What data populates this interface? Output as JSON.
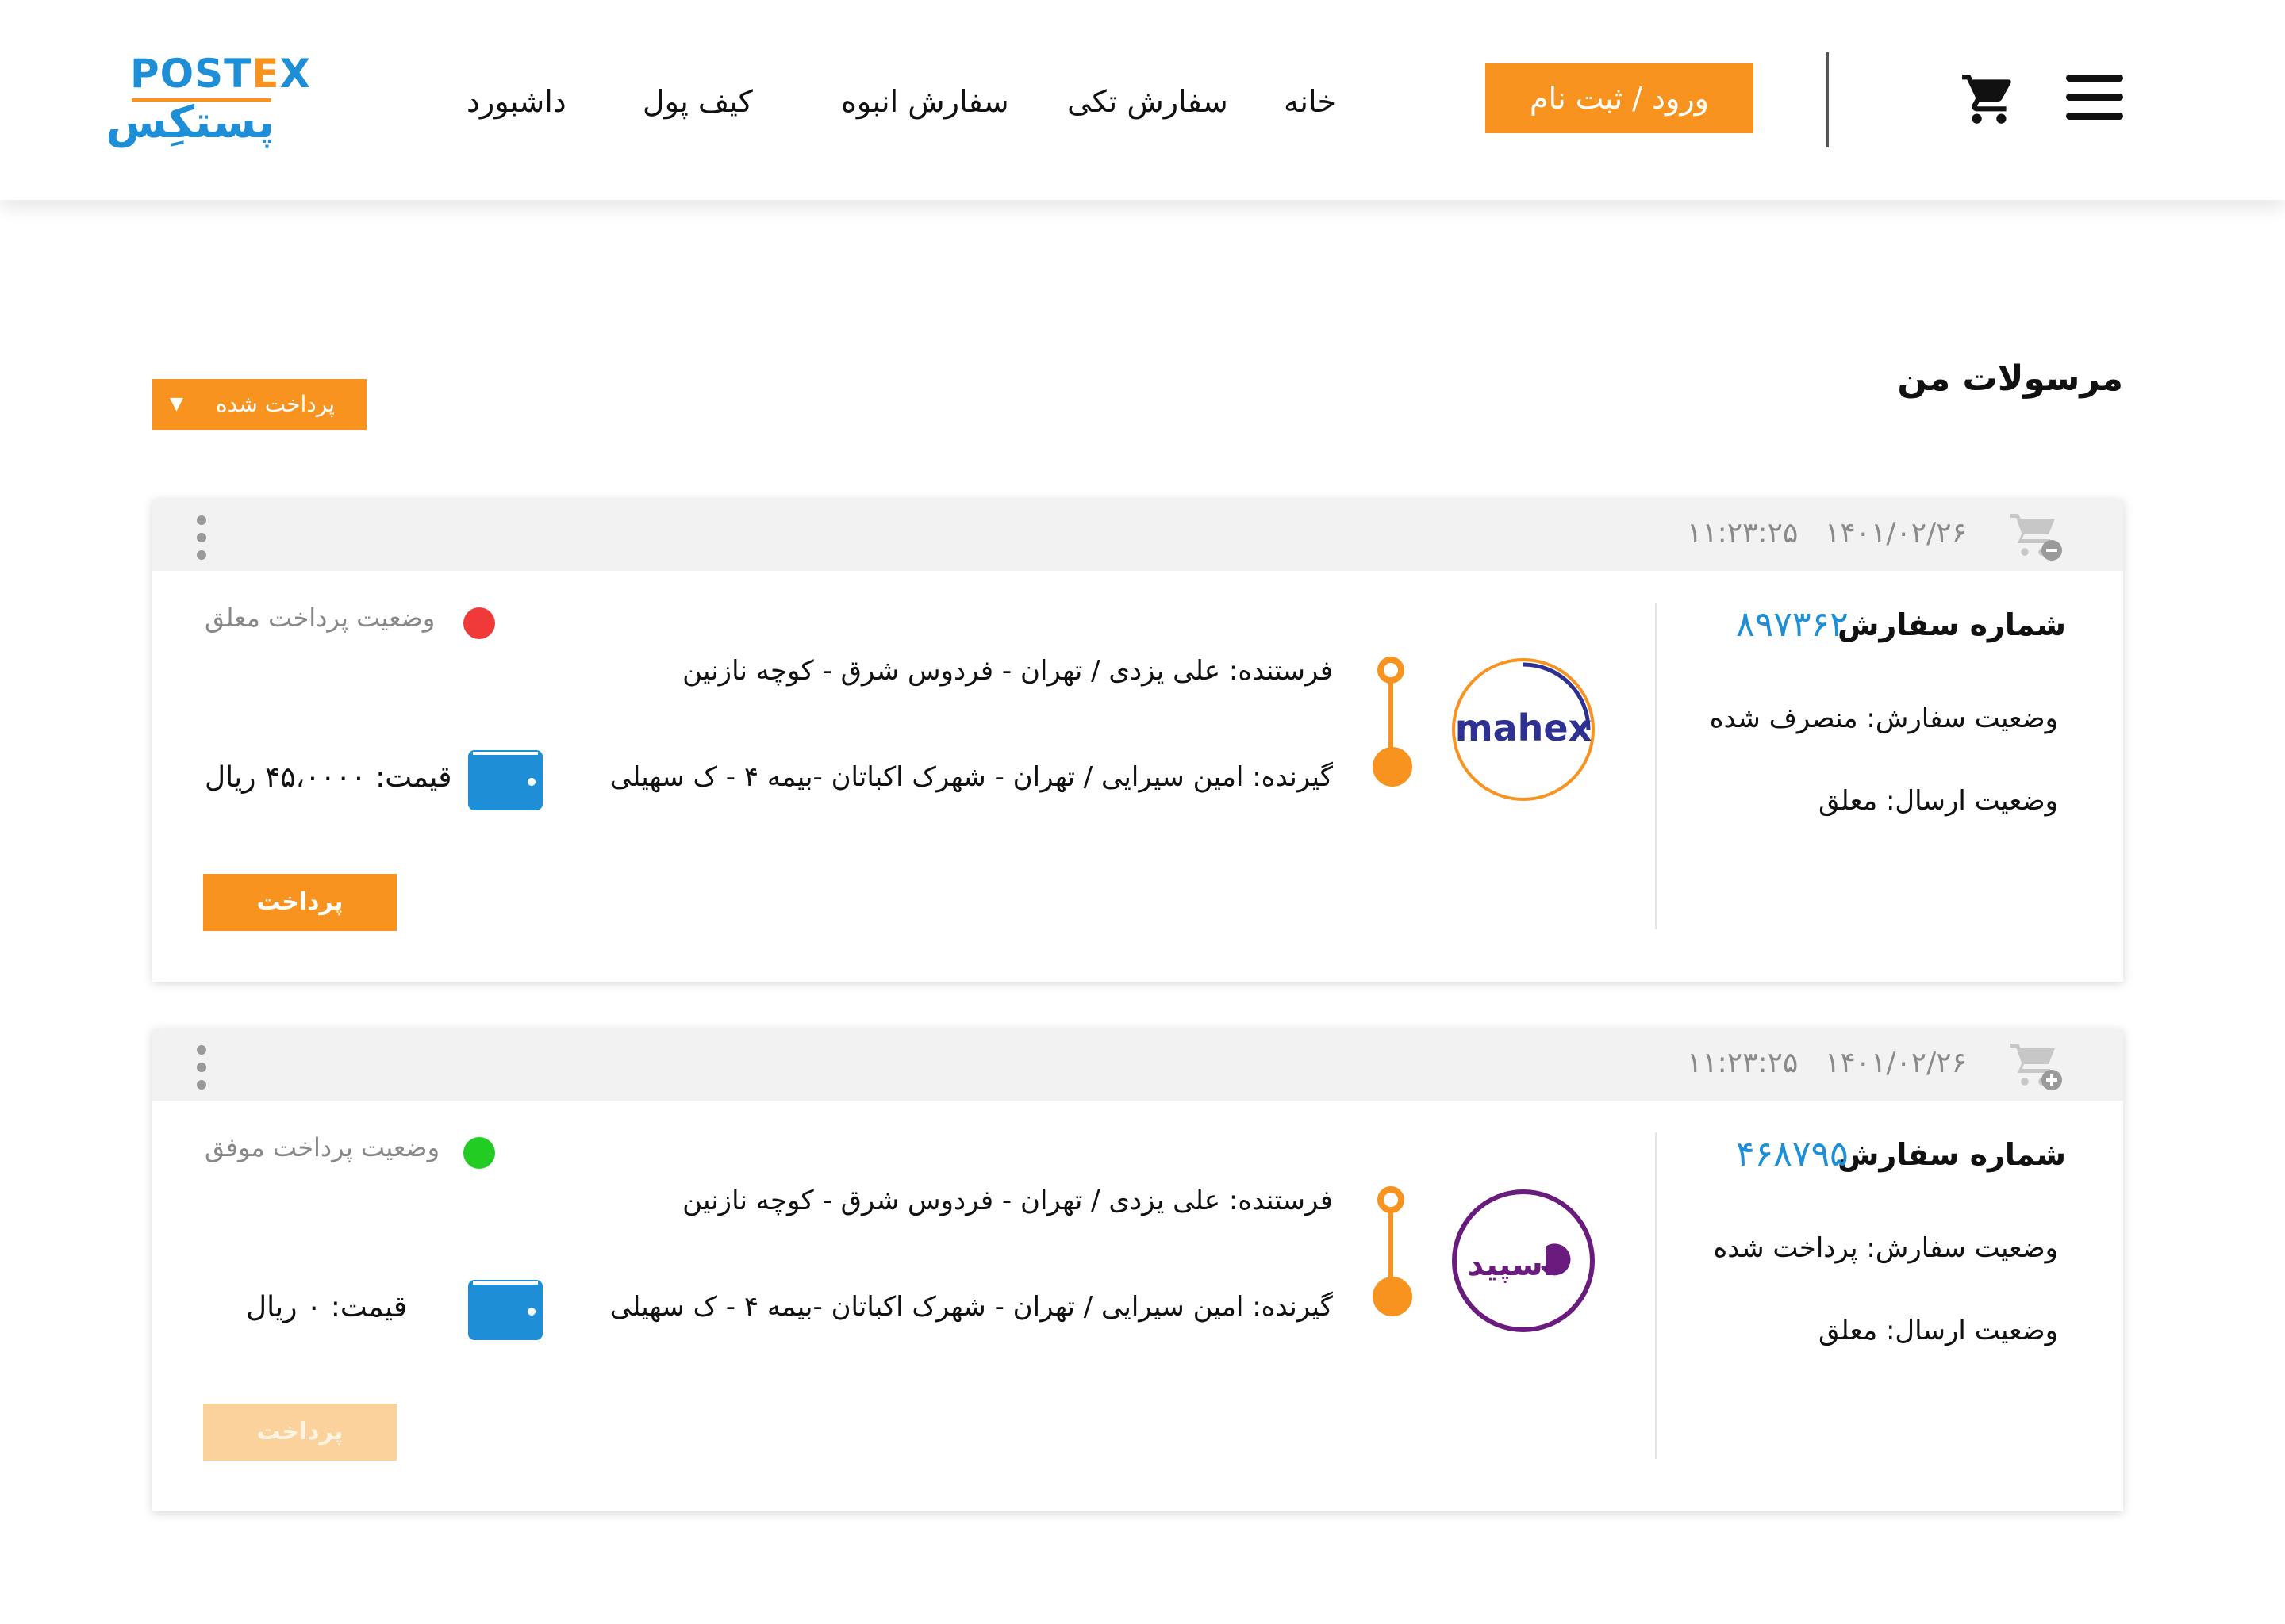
{
  "header": {
    "logo_text_left": "POST",
    "logo_text_x": "E",
    "logo_text_right": "X",
    "logo_fa": "پستکِس",
    "login_label": "ورود / ثبت نام",
    "nav": [
      "خانه",
      "سفارش تکی",
      "سفارش انبوه",
      "کیف پول",
      "داشبورد"
    ]
  },
  "page": {
    "title": "مرسولات من",
    "filter_label": "پرداخت شده",
    "filter_arrow": "▼"
  },
  "orders": [
    {
      "date": "۱۴۰۱/۰۲/۲۶",
      "time": "۱۱:۲۳:۲۵",
      "order_number_label": "شماره سفارش",
      "order_number": "۸۹۷۳۶۲",
      "order_status": "وضعیت سفارش:  منصرف شده",
      "shipping_status": "وضعیت ارسال: معلق",
      "carrier_logo_text": "mahex",
      "sender": "فرستنده: علی یزدی / تهران - فردوس شرق - کوچه نازنین",
      "receiver": "گیرنده: امین سیرایی / تهران - شهرک اکباتان -بیمه ۴ - ک سهیلی",
      "payment_status": "وضعیت پرداخت معلق",
      "payment_status_color": "#f03a3a",
      "price": "قیمت: ۴۵،۰۰۰۰ ریال",
      "pay_button": "پرداخت",
      "pay_enabled": true
    },
    {
      "date": "۱۴۰۱/۰۲/۲۶",
      "time": "۱۱:۲۳:۲۵",
      "order_number_label": "شماره سفارش",
      "order_number": "۴۶۸۷۹۵",
      "order_status": "وضعیت سفارش: پرداخت شده",
      "shipping_status": "وضعیت ارسال: معلق",
      "carrier_logo_text": "اسپید",
      "sender": "فرستنده: علی یزدی / تهران - فردوس شرق - کوچه نازنین",
      "receiver": "گیرنده: امین سیرایی / تهران - شهرک اکباتان -بیمه ۴ - ک سهیلی",
      "payment_status": "وضعیت پرداخت موفق",
      "payment_status_color": "#22cc22",
      "price": "قیمت: ۰ ریال",
      "pay_button": "پرداخت",
      "pay_enabled": false
    }
  ],
  "colors": {
    "accent": "#f7931e",
    "brand_blue": "#1e8fd6",
    "wallet_blue": "#1e8fd6"
  }
}
